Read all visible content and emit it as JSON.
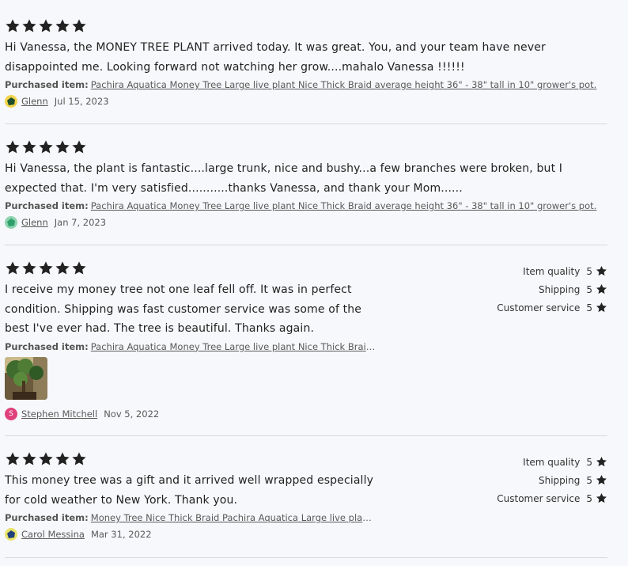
{
  "purchased_label": "Purchased item:",
  "reviews": [
    {
      "stars": 5,
      "text": "Hi Vanessa, the MONEY TREE PLANT arrived today. It was great. You, and your team have never disappointed me. Looking forward not watching her grow....mahalo Vanessa !!!!!!",
      "item": "Pachira Aquatica Money Tree Large live plant Nice Thick Braid average height 36\" - 38\" tall in 10\" grower's pot.",
      "reviewer": "Glenn",
      "date": "Jul 15, 2023"
    },
    {
      "stars": 5,
      "text": "Hi Vanessa, the plant is fantastic....large trunk, nice and bushy...a few branches were broken, but I expected that. I'm very satisfied...........thanks Vanessa, and thank your Mom......",
      "item": "Pachira Aquatica Money Tree Large live plant Nice Thick Braid average height 36\" - 38\" tall in 10\" grower's pot.",
      "reviewer": "Glenn",
      "date": "Jan 7, 2023"
    },
    {
      "stars": 5,
      "text": "I receive my money tree not one leaf fell off. It was in perfect condition. Shipping was fast customer service was some of the best I've ever had. The tree is beautiful. Thanks again.",
      "item": "Pachira Aquatica Money Tree Large live plant Nice Thick Braid a...",
      "reviewer": "Stephen Mitchell",
      "avatar_letter": "S",
      "date": "Nov 5, 2022",
      "ratings": [
        {
          "label": "Item quality",
          "value": "5"
        },
        {
          "label": "Shipping",
          "value": "5"
        },
        {
          "label": "Customer service",
          "value": "5"
        }
      ]
    },
    {
      "stars": 5,
      "text": "This money tree was a gift and it arrived well wrapped especially for cold weather to New York. Thank you.",
      "item": "Money Tree Nice Thick Braid Pachira Aquatica Large live plant a...",
      "reviewer": "Carol Messina",
      "date": "Mar 31, 2022",
      "ratings": [
        {
          "label": "Item quality",
          "value": "5"
        },
        {
          "label": "Shipping",
          "value": "5"
        },
        {
          "label": "Customer service",
          "value": "5"
        }
      ]
    }
  ]
}
